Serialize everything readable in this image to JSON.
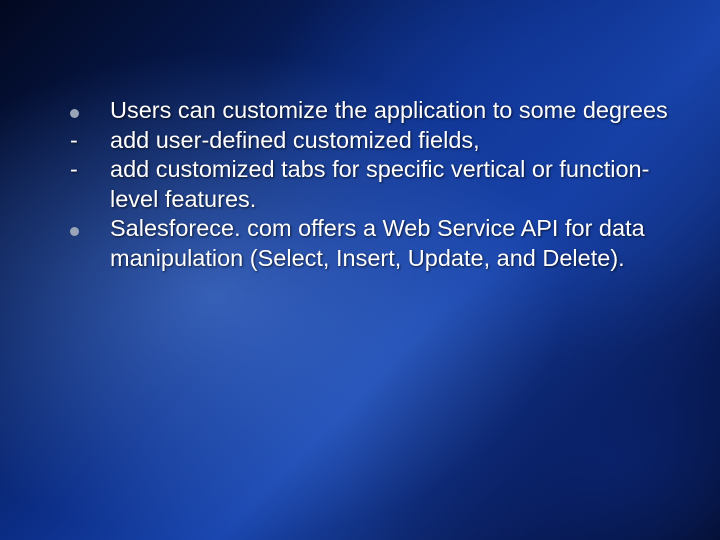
{
  "slide": {
    "items": [
      {
        "kind": "bullet",
        "text": "Users can customize the application to some degrees"
      },
      {
        "kind": "dash",
        "text": "add user-defined customized fields,"
      },
      {
        "kind": "dash",
        "text": "add customized tabs for specific vertical or function-level features."
      },
      {
        "kind": "bullet",
        "text": "Salesforece. com offers a Web Service API for data manipulation (Select, Insert, Update, and Delete)."
      }
    ],
    "dash_glyph": "-"
  }
}
